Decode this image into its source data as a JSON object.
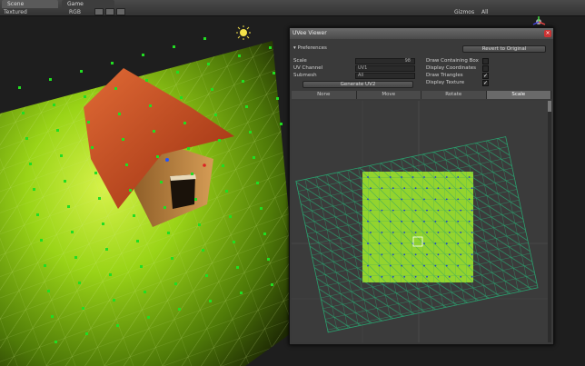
{
  "tabs": [
    {
      "label": "Scene"
    },
    {
      "label": "Game"
    }
  ],
  "scene_toolbar": {
    "shading": "Textured",
    "mode": "RGB",
    "gizmos": "Gizmos",
    "search": "All"
  },
  "uv_window": {
    "title": "UVee Viewer",
    "preferences_label": "▾ Preferences",
    "revert_button": "Revert to Original",
    "scale_label": "Scale",
    "scale_value": "98",
    "uv_channel_label": "UV Channel",
    "uv_channel_value": "UV1",
    "submesh_label": "Submesh",
    "submesh_value": "All",
    "generate_button": "Generate UV2",
    "options": [
      {
        "label": "Draw Containing Box",
        "checked": false
      },
      {
        "label": "Display Coordinates",
        "checked": false
      },
      {
        "label": "Draw Triangles",
        "checked": true
      },
      {
        "label": "Display Texture",
        "checked": true
      }
    ],
    "tools": [
      {
        "label": "None",
        "active": false
      },
      {
        "label": "Move",
        "active": false
      },
      {
        "label": "Rotate",
        "active": false
      },
      {
        "label": "Scale",
        "active": true
      }
    ]
  },
  "colors": {
    "terrain": "#8ed10f",
    "vertex": "#22dd22",
    "wire": "#2b8f6a",
    "roof": "#d9572a",
    "wall": "#c48a45"
  }
}
